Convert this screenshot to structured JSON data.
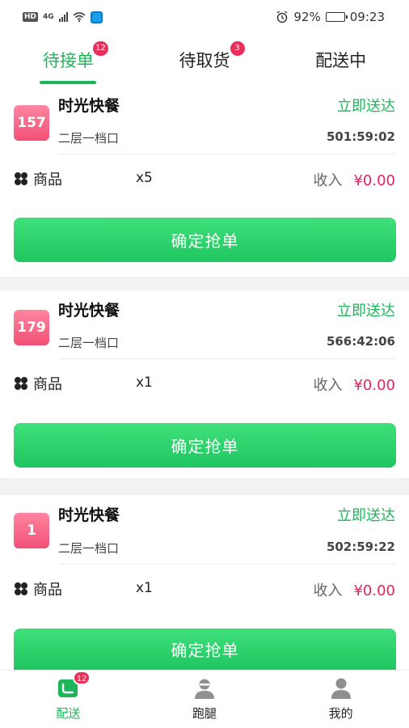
{
  "status_bar": {
    "network": "4G",
    "battery": "92%",
    "battery_level": 0.92,
    "time": "09:23"
  },
  "tabs": [
    {
      "label": "待接单",
      "badge": "12",
      "active": true
    },
    {
      "label": "待取货",
      "badge": "3",
      "active": false
    },
    {
      "label": "配送中",
      "badge": "",
      "active": false
    }
  ],
  "orders": [
    {
      "number": "157",
      "shop": "时光快餐",
      "delivery": "立即送达",
      "address": "二层一档口",
      "timer": "501:59:02",
      "goods_label": "商品",
      "qty": "x5",
      "income_label": "收入",
      "income": "¥0.00",
      "button": "确定抢单"
    },
    {
      "number": "179",
      "shop": "时光快餐",
      "delivery": "立即送达",
      "address": "二层一档口",
      "timer": "566:42:06",
      "goods_label": "商品",
      "qty": "x1",
      "income_label": "收入",
      "income": "¥0.00",
      "button": "确定抢单"
    },
    {
      "number": "1",
      "shop": "时光快餐",
      "delivery": "立即送达",
      "address": "二层一档口",
      "timer": "502:59:22",
      "goods_label": "商品",
      "qty": "x1",
      "income_label": "收入",
      "income": "¥0.00",
      "button": "确定抢单"
    }
  ],
  "bottom_nav": [
    {
      "label": "配送",
      "badge": "12",
      "icon": "delivery-icon",
      "active": true
    },
    {
      "label": "跑腿",
      "badge": "",
      "icon": "courier-icon",
      "active": false
    },
    {
      "label": "我的",
      "badge": "",
      "icon": "profile-icon",
      "active": false
    }
  ],
  "colors": {
    "accent": "#1db55a",
    "badge": "#e9305a",
    "price": "#e0245e"
  }
}
